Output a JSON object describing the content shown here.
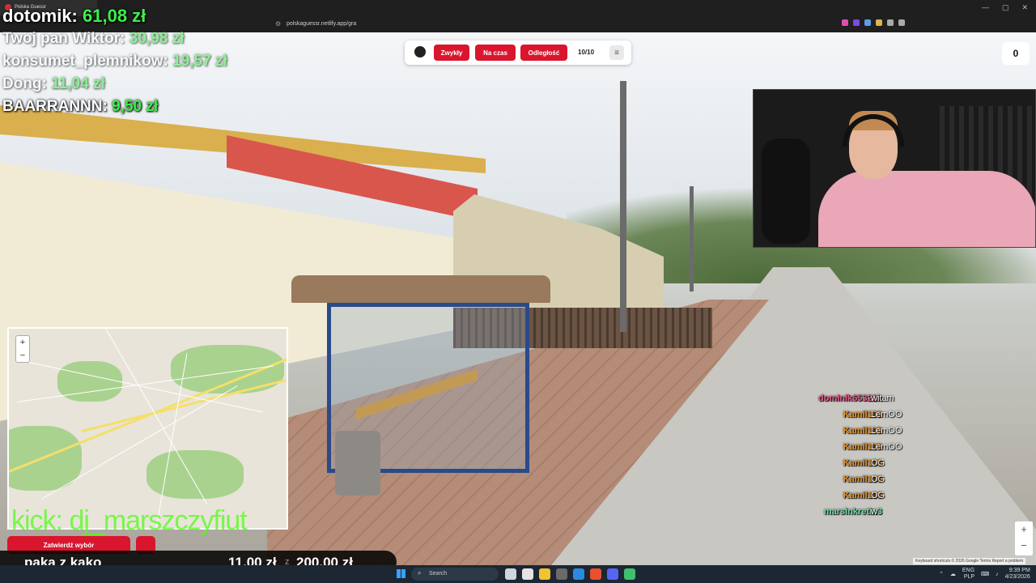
{
  "browser": {
    "tab_title": "Polska Guessr",
    "url": "polskaguessr.netlify.app/gra",
    "window_controls": [
      "—",
      "▢",
      "✕"
    ]
  },
  "donations": [
    {
      "name": "dotomik:",
      "amount": "61,08 zł"
    },
    {
      "name": "Twoj pan Wiktor:",
      "amount": "30,98 zł"
    },
    {
      "name": "konsumet_plemnikow:",
      "amount": "19,57 zł"
    },
    {
      "name": "Dong:",
      "amount": "11,04 zł"
    },
    {
      "name": "BAARRANNN:",
      "amount": "9,50 zł"
    }
  ],
  "game": {
    "buttons": {
      "normal": "Zwykły",
      "timed": "Na czas",
      "distance": "Odległość"
    },
    "round": "10/10",
    "score": "0",
    "confirm_label": "Zatwierdź wybór"
  },
  "watermark": "kick: dj_marszczyfiut",
  "goal": {
    "name": "paka z kako",
    "current": "11,00 zł",
    "separator": "z",
    "target": "200,00 zł"
  },
  "chat": [
    {
      "user": "dominik65321k",
      "color": "#e05a8a",
      "message": "witam"
    },
    {
      "user": "Kamil109",
      "color": "#e8952e",
      "message": "LemOO"
    },
    {
      "user": "Kamil109",
      "color": "#e8952e",
      "message": "LemOO"
    },
    {
      "user": "Kamil109",
      "color": "#e8952e",
      "message": "LemOO"
    },
    {
      "user": "Kamil109",
      "color": "#e8952e",
      "message": "OG"
    },
    {
      "user": "Kamil109",
      "color": "#e8952e",
      "message": "OG"
    },
    {
      "user": "Kamil109",
      "color": "#e8952e",
      "message": "OG"
    },
    {
      "user": "marsinkretin3",
      "color": "#6fe0a8",
      "message": "w"
    }
  ],
  "map": {
    "zoom_in": "+",
    "zoom_out": "−"
  },
  "streetview": {
    "zoom_in": "+",
    "zoom_out": "−",
    "attribution": "Keyboard shortcuts  © 2026 Google  Terms  Report a problem"
  },
  "taskbar": {
    "search_placeholder": "Search",
    "lang_top": "ENG",
    "lang_bottom": "PLP",
    "time": "9:39 PM",
    "date": "4/23/2026"
  },
  "colors": {
    "accent_red": "#d9162e",
    "donation_green": "#3cf04a",
    "kick_green": "#53fc18"
  }
}
